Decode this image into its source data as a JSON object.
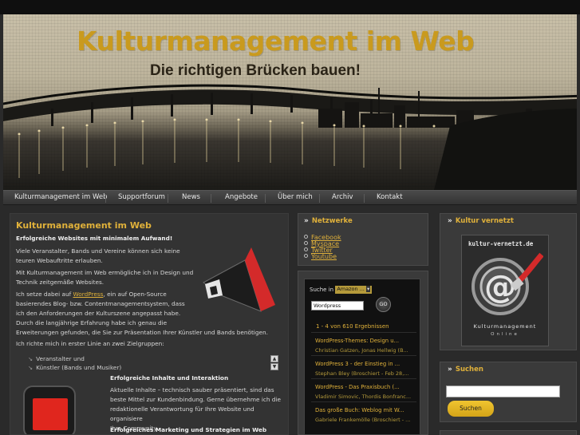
{
  "header": {
    "title": "Kulturmanagement im Web",
    "tagline": "Die richtigen Brücken bauen!"
  },
  "nav": {
    "items": [
      "Kulturmanagement im Web",
      "Supportforum",
      "News",
      "Angebote",
      "Über mich",
      "Archiv",
      "Kontakt"
    ]
  },
  "main": {
    "heading": "Kulturmanagement im Web",
    "subheading": "Erfolgreiche Websites mit minimalem Aufwand!",
    "p1_line1": "Viele Veranstalter, Bands und Vereine können sich keine",
    "p1_line2": "teuren Webauftritte erlauben.",
    "p2_line1": "Mit Kulturmanagement im Web ermögliche ich in Design und",
    "p2_line2": "Technik zeitgemäße Websites.",
    "p3_prefix": "Ich setze dabei auf ",
    "p3_link": "WordPress",
    "p3_suffix": ", ein auf Open-Source",
    "p3_line2": "basierendes Blog- bzw. Contentmanagementsystem, dass",
    "p3_line3": "ich den Anforderungen der Kulturszene angepasst habe.",
    "p3_line4": "Durch die langjährige Erfahrung habe ich genau die",
    "p3_line5": "Erweiterungen gefunden, die Sie zur Präsentation Ihrer Künstler und Bands benötigen.",
    "p4": "Ich richte mich in erster Linie an zwei Zielgruppen:",
    "targets": [
      "Veranstalter und",
      "Künstler (Bands und Musiker)"
    ],
    "feature1_title": "Erfolgreiche Inhalte und Interaktion",
    "feature1_line1": "Aktuelle Inhalte – technisch sauber präsentiert, sind das",
    "feature1_line2": "beste Mittel zur Kundenbindung. Gerne übernehme ich die",
    "feature1_line3": "redaktionelle Verantwortung für Ihre Website und organisiere",
    "feature1_line4": "Ihre Community.",
    "feature2_title": "Erfolgreiches Marketing und Strategien im Web"
  },
  "netzwerke": {
    "title": "Netzwerke",
    "links": [
      "Facebook",
      "Myspace",
      "Twitter",
      "Youtube"
    ]
  },
  "amazon": {
    "search_label": "Suche in",
    "select_value": "Amazon ...",
    "query": "Wordpress",
    "go_label": "GO",
    "results_summary": "1 - 4 von 610 Ergebnissen",
    "results": [
      {
        "title": "WordPress-Themes: Design u...",
        "author": "Christian Gatzen, Jonas Hellwig (B..."
      },
      {
        "title": "WordPress 3 - der Einstieg in ...",
        "author": "Stephan Bley (Broschiert - Feb 28,..."
      },
      {
        "title": "WordPress - Das Praxisbuch (...",
        "author": "Vladimir Simovic, Thordis Bonfranc..."
      },
      {
        "title": "Das große Buch: Weblog mit W...",
        "author": "Gabriele Frankemölle (Broschiert - ..."
      }
    ]
  },
  "kultur_vernetzt": {
    "title": "Kultur vernetzt",
    "logo_url_text": "kultur-vernetzt.de",
    "logo_line1": "Kulturmanagement",
    "logo_line2": "Online"
  },
  "suchen": {
    "title": "Suchen",
    "button": "Suchen"
  },
  "colors": {
    "accent": "#e0b13a",
    "title_gold": "#c99a1e",
    "megaphone_red": "#d42a2a"
  }
}
